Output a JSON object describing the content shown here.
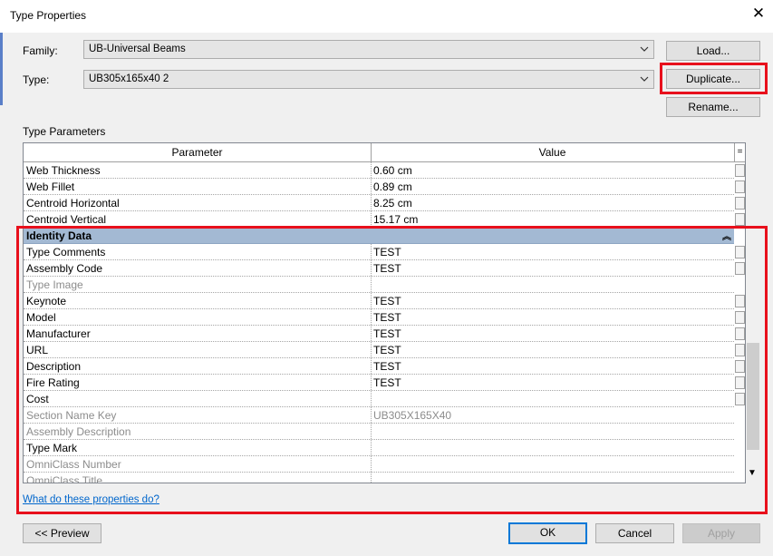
{
  "window": {
    "title": "Type Properties"
  },
  "family": {
    "label": "Family:",
    "value": "UB-Universal Beams"
  },
  "type": {
    "label": "Type:",
    "value": "UB305x165x40 2"
  },
  "buttons": {
    "load": "Load...",
    "duplicate": "Duplicate...",
    "rename": "Rename...",
    "preview": "<< Preview",
    "ok": "OK",
    "cancel": "Cancel",
    "apply": "Apply"
  },
  "type_parameters": {
    "label": "Type Parameters",
    "headers": {
      "parameter": "Parameter",
      "value": "Value",
      "extra": "="
    },
    "rows_before": [
      {
        "p": "Web Thickness",
        "v": "0.60 cm"
      },
      {
        "p": "Web Fillet",
        "v": "0.89 cm"
      },
      {
        "p": "Centroid Horizontal",
        "v": "8.25 cm"
      },
      {
        "p": "Centroid Vertical",
        "v": "15.17 cm"
      }
    ],
    "group": {
      "title": "Identity Data",
      "collapse": "»"
    },
    "rows_after": [
      {
        "p": "Type Comments",
        "v": "TEST"
      },
      {
        "p": "Assembly Code",
        "v": "TEST"
      },
      {
        "p": "Type Image",
        "v": ""
      },
      {
        "p": "Keynote",
        "v": "TEST"
      },
      {
        "p": "Model",
        "v": "TEST"
      },
      {
        "p": "Manufacturer",
        "v": "TEST"
      },
      {
        "p": "URL",
        "v": "TEST"
      },
      {
        "p": "Description",
        "v": "TEST"
      },
      {
        "p": "Fire Rating",
        "v": "TEST"
      },
      {
        "p": "Cost",
        "v": ""
      },
      {
        "p": "Section Name Key",
        "v": "UB305X165X40"
      },
      {
        "p": "Assembly Description",
        "v": ""
      },
      {
        "p": "Type Mark",
        "v": ""
      },
      {
        "p": "OmniClass Number",
        "v": ""
      },
      {
        "p": "OmniClass Title",
        "v": ""
      }
    ]
  },
  "help_link": "What do these properties do?"
}
